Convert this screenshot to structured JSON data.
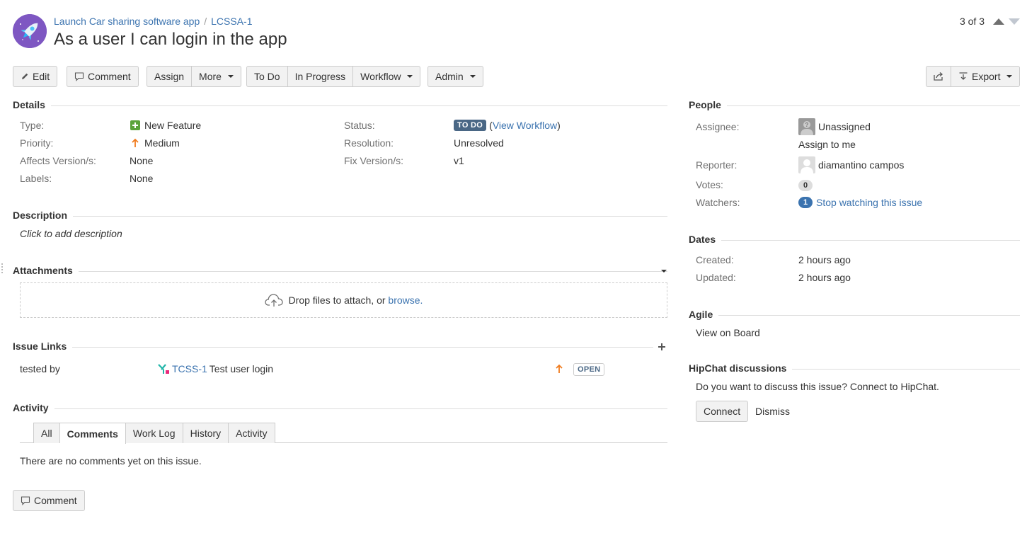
{
  "header": {
    "breadcrumb_project": "Launch Car sharing software app",
    "breadcrumb_sep": "/",
    "breadcrumb_key": "LCSSA-1",
    "title": "As a user I can login in the app",
    "pager": "3 of 3"
  },
  "toolbar": {
    "edit": "Edit",
    "comment": "Comment",
    "assign": "Assign",
    "more": "More",
    "todo": "To Do",
    "in_progress": "In Progress",
    "workflow": "Workflow",
    "admin": "Admin",
    "export": "Export"
  },
  "details": {
    "title": "Details",
    "type_label": "Type:",
    "type_value": "New Feature",
    "priority_label": "Priority:",
    "priority_value": "Medium",
    "affects_label": "Affects Version/s:",
    "affects_value": "None",
    "labels_label": "Labels:",
    "labels_value": "None",
    "status_label": "Status:",
    "status_value": "TO DO",
    "status_open_paren": "(",
    "status_link": "View Workflow",
    "status_close_paren": ")",
    "resolution_label": "Resolution:",
    "resolution_value": "Unresolved",
    "fix_label": "Fix Version/s:",
    "fix_value": "v1"
  },
  "description": {
    "title": "Description",
    "placeholder": "Click to add description"
  },
  "attachments": {
    "title": "Attachments",
    "drop_text": "Drop files to attach, or",
    "browse": "browse."
  },
  "issue_links": {
    "title": "Issue Links",
    "relation": "tested by",
    "key": "TCSS-1",
    "summary": "Test user login",
    "status": "OPEN"
  },
  "activity": {
    "title": "Activity",
    "tabs": [
      "All",
      "Comments",
      "Work Log",
      "History",
      "Activity"
    ],
    "active_tab": "Comments",
    "empty": "There are no comments yet on this issue.",
    "comment_button": "Comment"
  },
  "people": {
    "title": "People",
    "assignee_label": "Assignee:",
    "assignee_value": "Unassigned",
    "assign_to_me": "Assign to me",
    "reporter_label": "Reporter:",
    "reporter_value": "diamantino campos",
    "votes_label": "Votes:",
    "votes_count": "0",
    "watchers_label": "Watchers:",
    "watchers_count": "1",
    "watch_link": "Stop watching this issue"
  },
  "dates": {
    "title": "Dates",
    "created_label": "Created:",
    "created_value": "2 hours ago",
    "updated_label": "Updated:",
    "updated_value": "2 hours ago"
  },
  "agile": {
    "title": "Agile",
    "link": "View on Board"
  },
  "hipchat": {
    "title": "HipChat discussions",
    "text": "Do you want to discuss this issue? Connect to HipChat.",
    "connect": "Connect",
    "dismiss": "Dismiss"
  },
  "colors": {
    "link": "#3b73af",
    "todo_lozenge": "#4a6785",
    "priority_medium": "#f07c1f",
    "new_feature": "#5aa33b",
    "project_avatar": "#7e57c2"
  }
}
